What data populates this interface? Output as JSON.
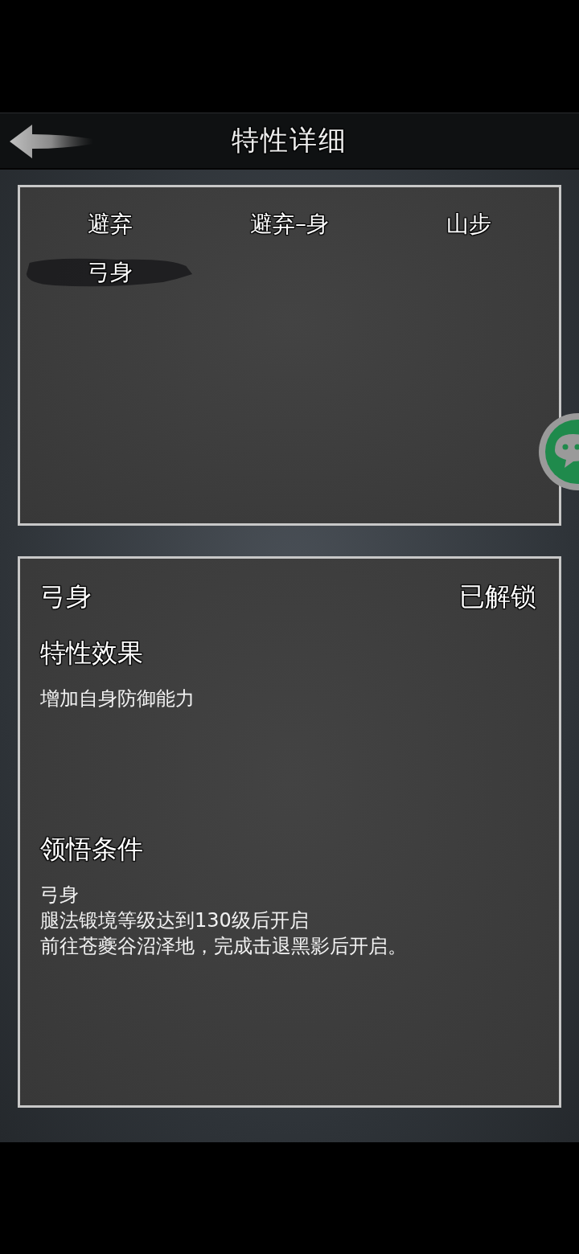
{
  "header": {
    "title": "特性详细"
  },
  "traits": [
    {
      "label": "避弃",
      "selected": false
    },
    {
      "label": "避弃–身",
      "selected": false
    },
    {
      "label": "山步",
      "selected": false
    },
    {
      "label": "弓身",
      "selected": true
    }
  ],
  "detail": {
    "name": "弓身",
    "status": "已解锁",
    "effect_title": "特性效果",
    "effect": "增加自身防御能力",
    "condition_title": "领悟条件",
    "conditions": [
      "弓身",
      "腿法锻境等级达到130级后开启",
      "前往苍夔谷沼泽地，完成击退黑影后开启。"
    ]
  }
}
